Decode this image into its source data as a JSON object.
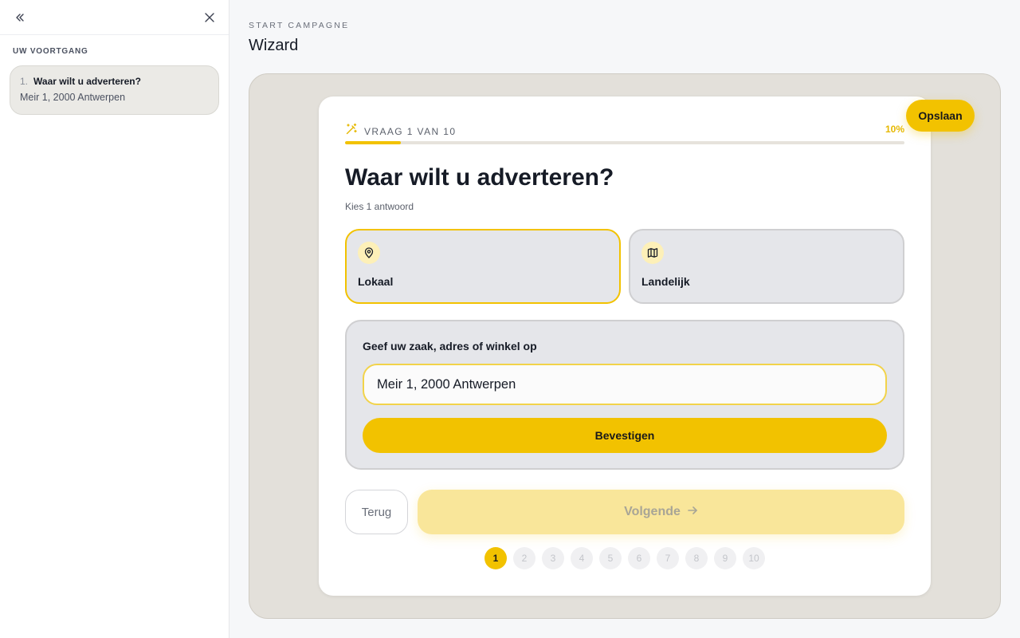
{
  "sidebar": {
    "heading": "UW VOORTGANG",
    "items": [
      {
        "number": "1.",
        "title": "Waar wilt u adverteren?",
        "answer": "Meir 1, 2000 Antwerpen"
      }
    ]
  },
  "header": {
    "eyebrow": "START CAMPAGNE",
    "title": "Wizard"
  },
  "toolbar": {
    "save_label": "Opslaan"
  },
  "wizard": {
    "step_label": "VRAAG 1 VAN 10",
    "progress_text": "10%",
    "progress": 0.1,
    "question": "Waar wilt u adverteren?",
    "hint": "Kies 1 antwoord",
    "options": [
      {
        "label": "Lokaal",
        "icon": "map-pin-icon",
        "selected": true
      },
      {
        "label": "Landelijk",
        "icon": "map-icon",
        "selected": false
      }
    ],
    "address": {
      "label": "Geef uw zaak, adres of winkel op",
      "value": "Meir 1, 2000 Antwerpen",
      "confirm_label": "Bevestigen"
    },
    "back_label": "Terug",
    "next_label": "Volgende",
    "steps": [
      "1",
      "2",
      "3",
      "4",
      "5",
      "6",
      "7",
      "8",
      "9",
      "10"
    ],
    "current_step": "1"
  },
  "colors": {
    "accent": "#f2c200",
    "accent_light": "#f9e69a",
    "frame": "#e3e0da"
  }
}
